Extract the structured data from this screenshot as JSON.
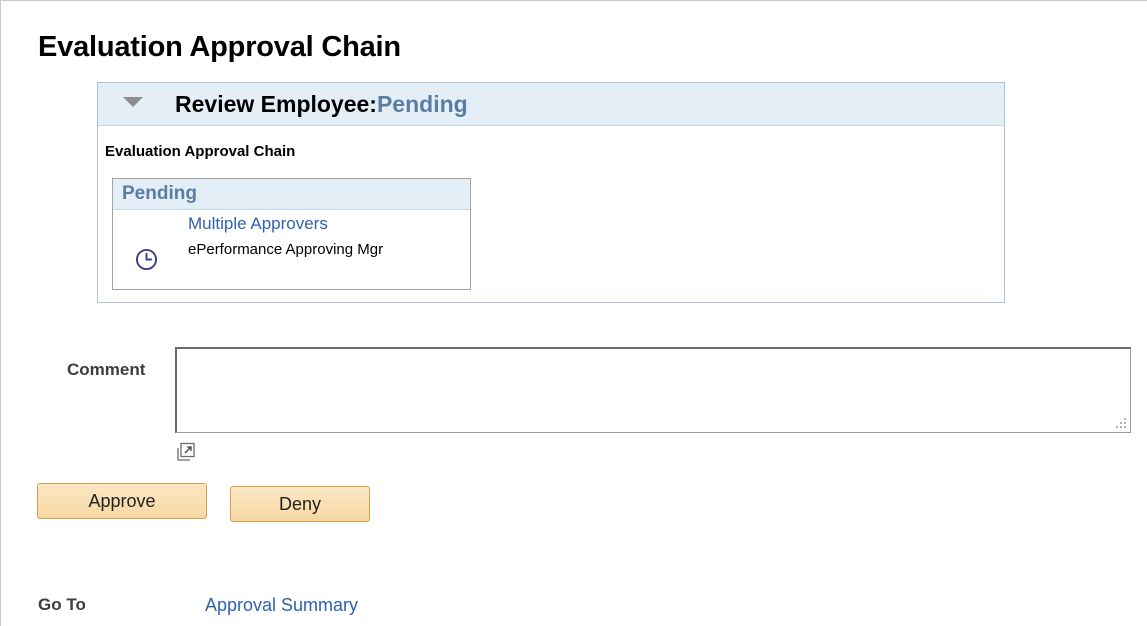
{
  "page": {
    "title": "Evaluation Approval Chain"
  },
  "stage": {
    "title": "Review Employee:",
    "status": "Pending",
    "chain_label": "Evaluation Approval Chain",
    "step": {
      "status": "Pending",
      "approvers_link": "Multiple Approvers",
      "role": "ePerformance Approving Mgr",
      "icon": "clock-icon"
    }
  },
  "comment": {
    "label": "Comment",
    "value": ""
  },
  "buttons": {
    "approve": "Approve",
    "deny": "Deny"
  },
  "goto": {
    "label": "Go To",
    "link": "Approval Summary"
  },
  "colors": {
    "link": "#2e62b1",
    "status": "#5a7ea3",
    "header_bg": "#e4eef7",
    "button_bg": "#f7d8a3",
    "button_border": "#d9a04a"
  }
}
